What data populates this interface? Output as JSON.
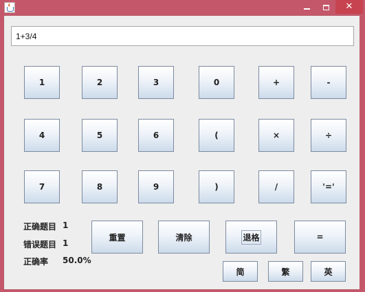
{
  "window": {
    "controls": {
      "minimize": "minimize",
      "maximize": "maximize",
      "close": "✕"
    }
  },
  "expression": {
    "value": "1+3/4"
  },
  "keypad": {
    "row1": [
      "1",
      "2",
      "3",
      "0",
      "+",
      "-"
    ],
    "row2": [
      "4",
      "5",
      "6",
      "(",
      "×",
      "÷"
    ],
    "row3": [
      "7",
      "8",
      "9",
      ")",
      "/",
      "'='"
    ]
  },
  "actions": {
    "reset": "重置",
    "clear": "清除",
    "backspace": "退格",
    "equals": "="
  },
  "stats": {
    "correct_label": "正确题目",
    "correct_value": "1",
    "wrong_label": "错误题目",
    "wrong_value": "1",
    "rate_label": "正确率",
    "rate_value": "50.0%"
  },
  "language": {
    "simplified": "简",
    "traditional": "繁",
    "english": "英"
  },
  "colors": {
    "title_bar": "#c4586a",
    "close_button": "#c7434f",
    "client_bg": "#eeeeee"
  }
}
